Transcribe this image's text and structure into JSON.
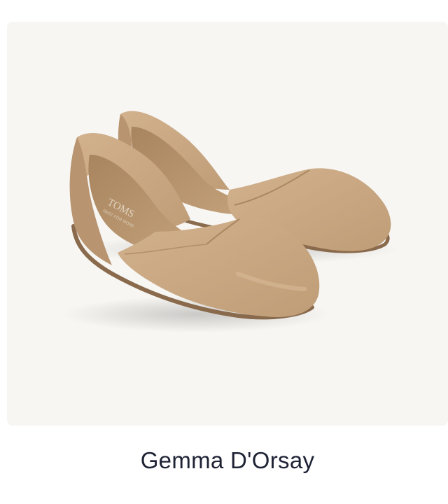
{
  "product": {
    "name": "Gemma D'Orsay",
    "image": {
      "subject": "shoe-pair-image",
      "brand_insole_text": "TOMS",
      "brand_insole_subtext": "BEST FOR MORE",
      "colors": {
        "panel_bg": "#f7f6f3",
        "suede": "#c9a883",
        "suede_shadow": "#a98862",
        "insole": "#b89673",
        "sole": "#8a6a4c",
        "name_text": "#1e2235"
      }
    }
  }
}
